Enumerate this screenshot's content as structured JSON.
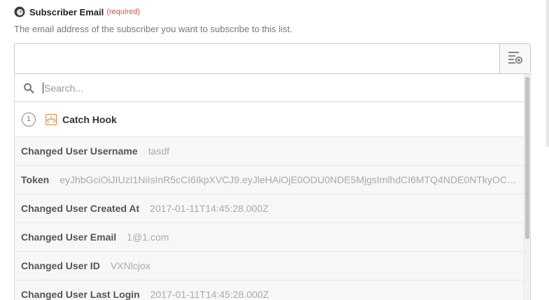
{
  "field": {
    "label": "Subscriber Email",
    "required": "(required)",
    "help": "The email address of the subscriber you want to subscribe to this list.",
    "value": ""
  },
  "insert_button_icon": "insert-field-icon",
  "search": {
    "placeholder": "Search..."
  },
  "step": {
    "number": "1",
    "title": "Catch Hook",
    "icon": "webhook-icon"
  },
  "options": [
    {
      "label": "Changed User Username",
      "value": "tasdf"
    },
    {
      "label": "Token",
      "value": "eyJhbGciOiJIUzI1NiIsInR5cCI6IkpXVCJ9.eyJleHAiOjE0ODU0NDE5MjgsImlhdCI6MTQ4NDE0NTkyOCwiY..."
    },
    {
      "label": "Changed User Created At",
      "value": "2017-01-11T14:45:28.000Z"
    },
    {
      "label": "Changed User Email",
      "value": "1@1.com"
    },
    {
      "label": "Changed User ID",
      "value": "VXNlcjox"
    },
    {
      "label": "Changed User Last Login",
      "value": "2017-01-11T14:45:28.000Z"
    }
  ],
  "colors": {
    "required": "#e0502e",
    "hook": "#e8823b"
  }
}
